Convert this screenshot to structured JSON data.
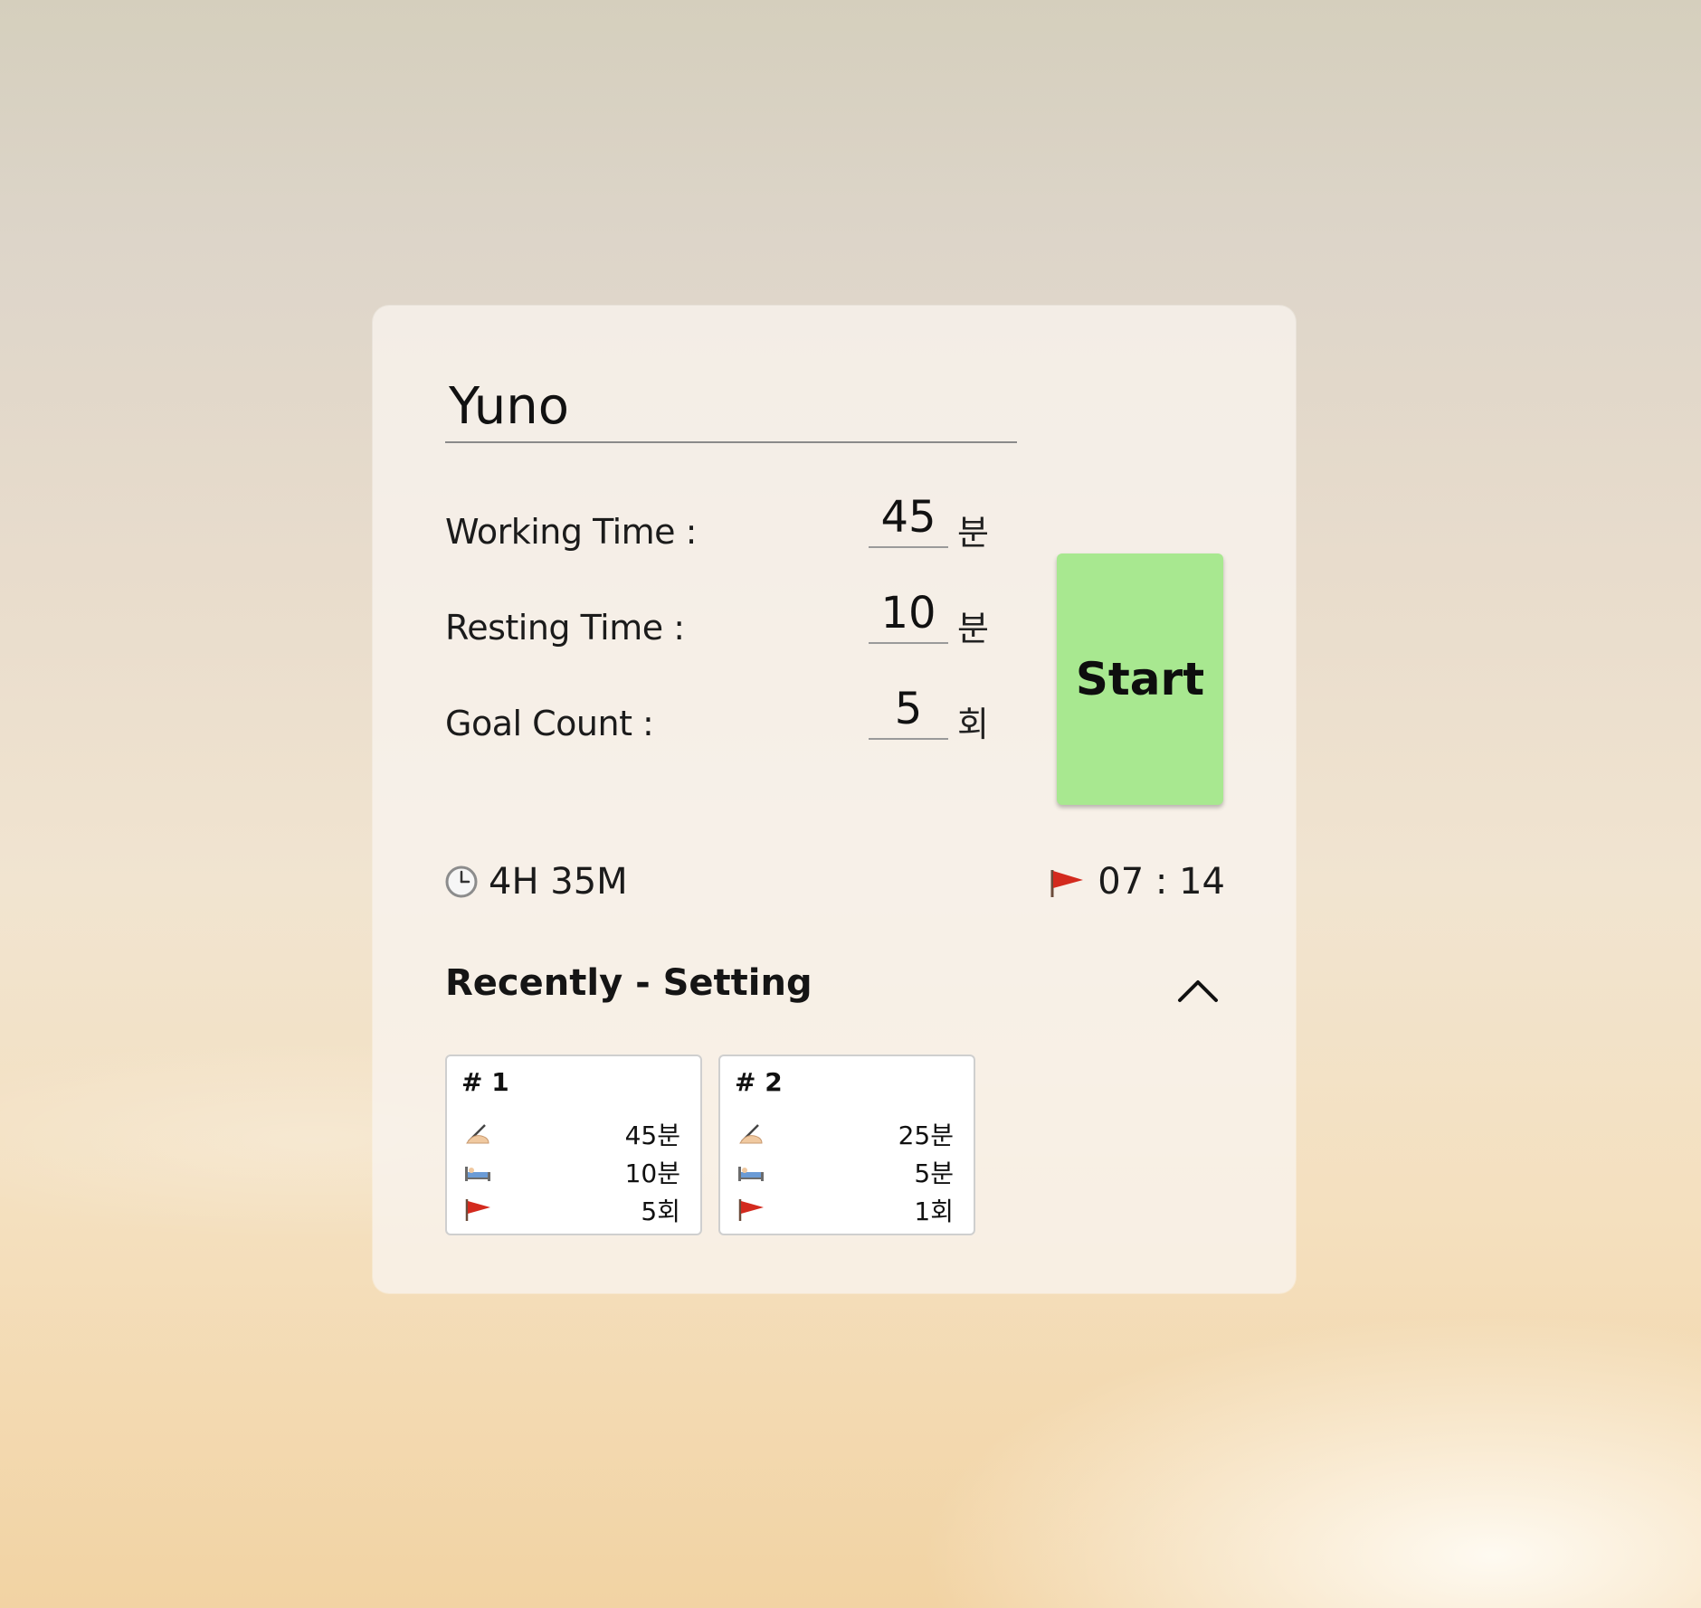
{
  "name": {
    "value": "Yuno"
  },
  "settings": {
    "working": {
      "label": "Working Time :",
      "value": "45",
      "unit": "분"
    },
    "resting": {
      "label": "Resting Time :",
      "value": "10",
      "unit": "분"
    },
    "goal": {
      "label": "Goal Count :",
      "value": "5",
      "unit": "회"
    }
  },
  "start_button": {
    "label": "Start",
    "color": "#a8e890"
  },
  "summary": {
    "total_time": "4H 35M",
    "total_icon": "clock-icon",
    "finish_time": "07 : 14",
    "finish_icon": "red-flag-icon"
  },
  "recent": {
    "title": "Recently - Setting",
    "toggle_icon": "chevron-up-icon",
    "presets": [
      {
        "title": "# 1",
        "working": "45분",
        "resting": "10분",
        "goal": "5회"
      },
      {
        "title": "# 2",
        "working": "25분",
        "resting": "5분",
        "goal": "1회"
      }
    ],
    "row_icons": [
      "writing-hand-icon",
      "bed-icon",
      "red-flag-icon"
    ]
  }
}
